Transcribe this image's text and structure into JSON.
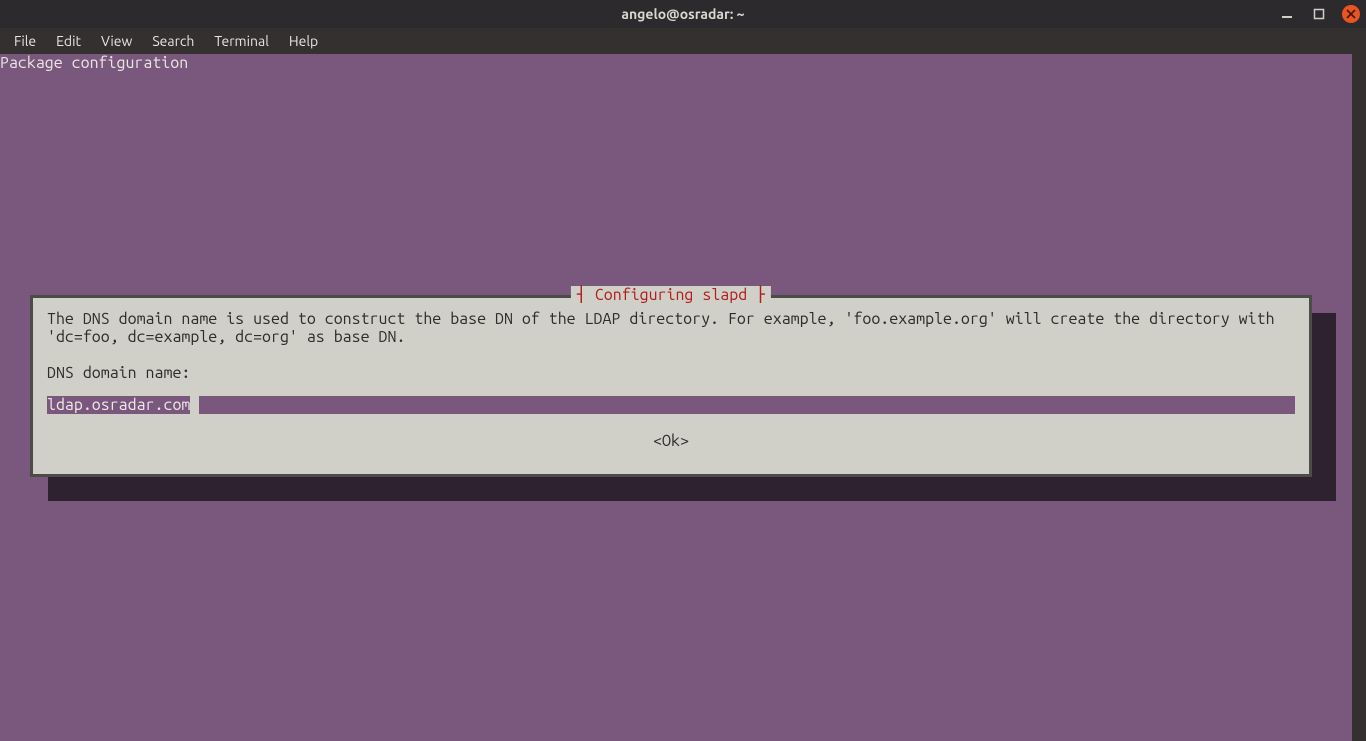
{
  "window": {
    "title": "angelo@osradar: ~"
  },
  "menubar": {
    "items": [
      "File",
      "Edit",
      "View",
      "Search",
      "Terminal",
      "Help"
    ]
  },
  "terminal": {
    "header": "Package configuration"
  },
  "dialog": {
    "title": "Configuring slapd",
    "body": "The DNS domain name is used to construct the base DN of the LDAP directory. For example, 'foo.example.org' will create the directory with 'dc=foo, dc=example, dc=org' as base DN.",
    "prompt": "DNS domain name:",
    "input_value": "ldap.osradar.com",
    "ok_label": "<Ok>"
  }
}
